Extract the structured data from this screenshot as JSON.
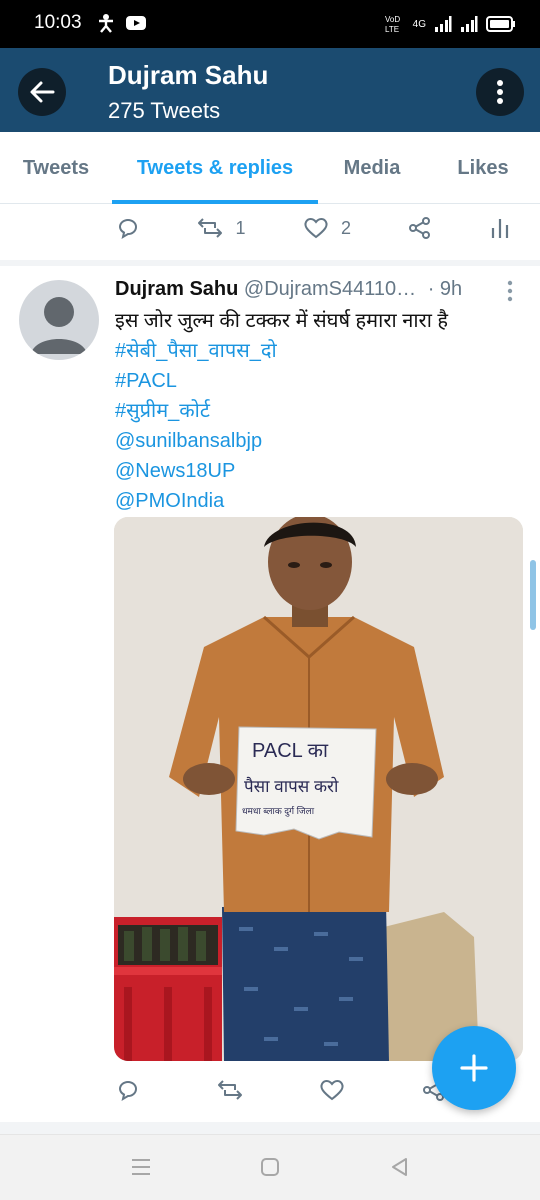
{
  "status": {
    "time": "10:03",
    "network_label": "4G"
  },
  "header": {
    "title": "Dujram Sahu",
    "subtitle": "275 Tweets"
  },
  "tabs": [
    {
      "label": "Tweets",
      "active": false
    },
    {
      "label": "Tweets & replies",
      "active": true
    },
    {
      "label": "Media",
      "active": false
    },
    {
      "label": "Likes",
      "active": false
    }
  ],
  "prev_tweet_actions": {
    "retweets": "1",
    "likes": "2"
  },
  "tweet": {
    "name": "Dujram Sahu",
    "handle": "@DujramS44110…",
    "time": "· 9h",
    "text": "इस जोर जुल्म की टक्कर में संघर्ष हमारा नारा है",
    "links": [
      "#सेबी_पैसा_वापस_दो",
      "#PACL",
      "#सुप्रीम_कोर्ट",
      "@sunilbansalbjp",
      "@News18UP",
      "@PMOIndia"
    ],
    "sign_text": [
      "PACL का",
      "पैसा वापस करो",
      "धमधा ब्लाक दुर्ग जिला"
    ]
  },
  "colors": {
    "app_bar": "#1b4b70",
    "accent": "#1da1f2",
    "link": "#1b95e0"
  }
}
